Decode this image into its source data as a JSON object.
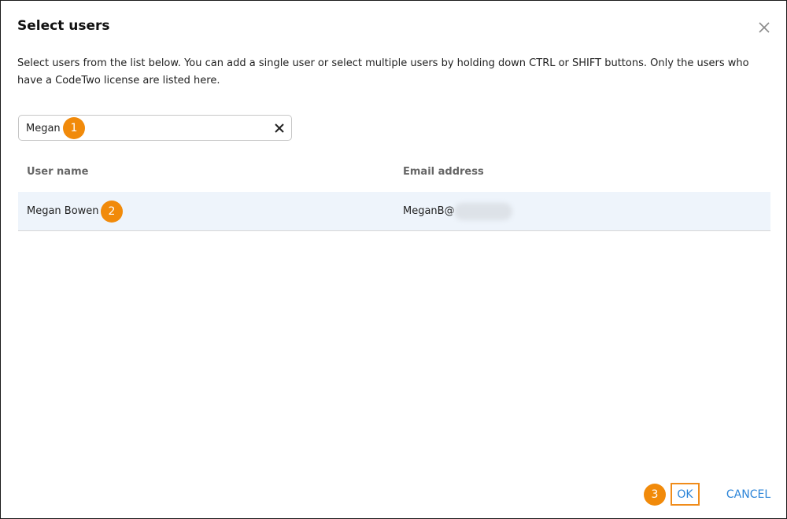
{
  "dialog": {
    "title": "Select users",
    "description": "Select users from the list below. You can add a single user or select multiple users by holding down CTRL or SHIFT buttons. Only the users who have a CodeTwo license are listed here.",
    "close_icon": "close-icon"
  },
  "search": {
    "value": "Megan",
    "clear_icon": "clear-icon"
  },
  "table": {
    "columns": [
      "User name",
      "Email address"
    ],
    "rows": [
      {
        "user_name": "Megan Bowen",
        "email": "MeganB@"
      }
    ]
  },
  "callouts": [
    "1",
    "2",
    "3"
  ],
  "footer": {
    "ok_label": "OK",
    "cancel_label": "CANCEL"
  },
  "colors": {
    "accent": "#2b84d8",
    "callout": "#f18a0a",
    "row_selected": "#eef4fb"
  }
}
